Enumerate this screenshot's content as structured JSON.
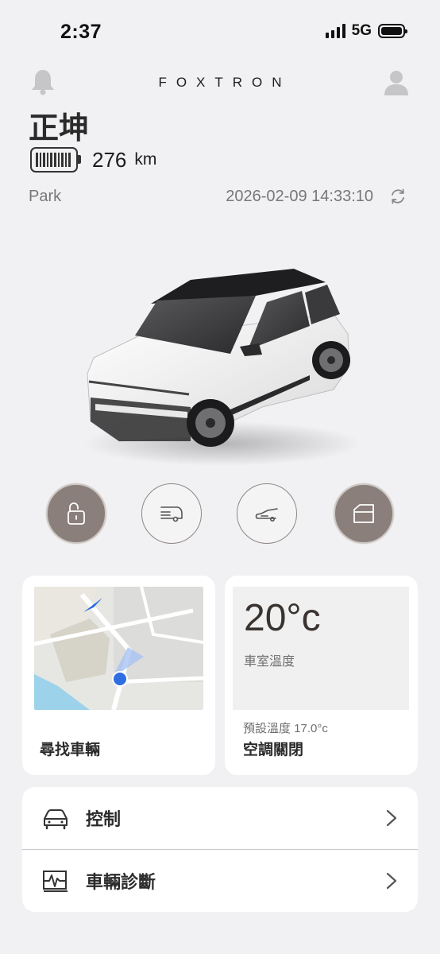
{
  "status_bar": {
    "time": "2:37",
    "network": "5G"
  },
  "header": {
    "brand": "FOXTRON"
  },
  "vehicle": {
    "name": "正坤",
    "range_value": "276",
    "range_unit": "km",
    "gear": "Park",
    "last_update": "2026-02-09 14:33:10"
  },
  "actions": [
    {
      "name": "unlock",
      "icon": "unlocked-padlock-icon",
      "active": true
    },
    {
      "name": "trunk",
      "icon": "trunk-icon",
      "active": false
    },
    {
      "name": "frunk",
      "icon": "frunk-icon",
      "active": false
    },
    {
      "name": "window",
      "icon": "window-icon",
      "active": true
    }
  ],
  "find_car": {
    "label": "尋找車輛"
  },
  "climate": {
    "cabin_temp": "20°c",
    "cabin_label": "車室溫度",
    "preset": "預設溫度 17.0°c",
    "status": "空調關閉"
  },
  "menu": [
    {
      "label": "控制",
      "icon": "car-icon"
    },
    {
      "label": "車輛診斷",
      "icon": "diagnostics-icon"
    }
  ],
  "colors": {
    "background": "#f1f1f3",
    "active_button": "#8a7f7a",
    "location_dot": "#2f6ee0"
  }
}
